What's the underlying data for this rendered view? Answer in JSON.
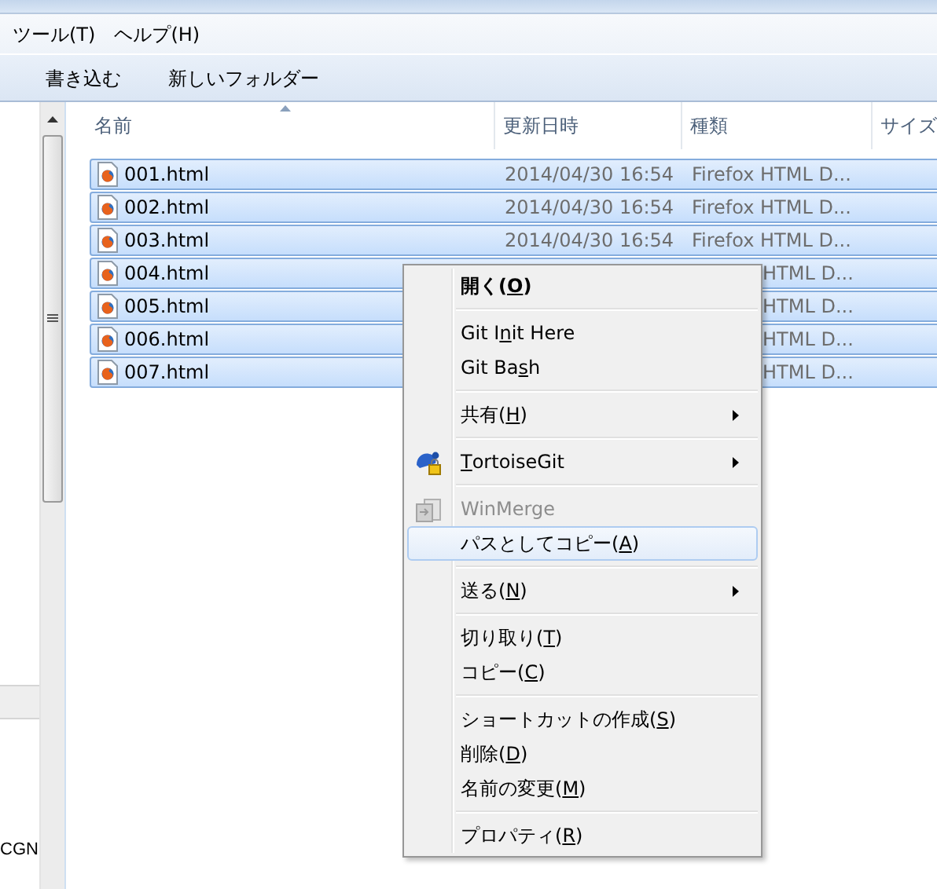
{
  "menu_bar": [
    "ツール(T)",
    "ヘルプ(H)"
  ],
  "toolbar": [
    "書き込む",
    "新しいフォルダー"
  ],
  "nav_pane": {
    "items": [
      "CGN"
    ]
  },
  "file_list": {
    "columns": [
      {
        "label": "名前",
        "sorted": true
      },
      {
        "label": "更新日時",
        "sorted": false
      },
      {
        "label": "種類",
        "sorted": false
      },
      {
        "label": "サイズ",
        "sorted": false
      }
    ],
    "rows": [
      {
        "name": "001.html",
        "date": "2014/04/30 16:54",
        "type": "Firefox HTML D...",
        "selected": true
      },
      {
        "name": "002.html",
        "date": "2014/04/30 16:54",
        "type": "Firefox HTML D...",
        "selected": true
      },
      {
        "name": "003.html",
        "date": "2014/04/30 16:54",
        "type": "Firefox HTML D...",
        "selected": true
      },
      {
        "name": "004.html",
        "type": "HTML D...",
        "selected": true
      },
      {
        "name": "005.html",
        "type": "HTML D...",
        "selected": true
      },
      {
        "name": "006.html",
        "type": "HTML D...",
        "selected": true
      },
      {
        "name": "007.html",
        "type": "HTML D...",
        "selected": true
      }
    ]
  },
  "context_menu": {
    "items": [
      {
        "kind": "item",
        "label": "開く(",
        "key": "O",
        "after": ")",
        "default": true,
        "disabled": false,
        "submenu": false,
        "highlighted": false
      },
      {
        "kind": "separator"
      },
      {
        "kind": "item",
        "label": "Git I",
        "key": "n",
        "after": "it Here",
        "default": false,
        "disabled": false,
        "submenu": false,
        "highlighted": false
      },
      {
        "kind": "item",
        "label": "Git Ba",
        "key": "s",
        "after": "h",
        "default": false,
        "disabled": false,
        "submenu": false,
        "highlighted": false
      },
      {
        "kind": "separator"
      },
      {
        "kind": "item",
        "label": "共有(",
        "key": "H",
        "after": ")",
        "default": false,
        "disabled": false,
        "submenu": true,
        "highlighted": false
      },
      {
        "kind": "separator"
      },
      {
        "kind": "tortoise",
        "key": "T",
        "after": "ortoiseGit",
        "default": false,
        "disabled": false,
        "submenu": true,
        "highlighted": false
      },
      {
        "kind": "separator"
      },
      {
        "kind": "merge",
        "label": "WinMerge",
        "default": false,
        "disabled": true,
        "submenu": false,
        "highlighted": false
      },
      {
        "kind": "item",
        "label": "パスとしてコピー(",
        "key": "A",
        "after": ")",
        "default": false,
        "disabled": false,
        "submenu": false,
        "highlighted": true
      },
      {
        "kind": "separator"
      },
      {
        "kind": "item",
        "label": "送る(",
        "key": "N",
        "after": ")",
        "default": false,
        "disabled": false,
        "submenu": true,
        "highlighted": false
      },
      {
        "kind": "separator"
      },
      {
        "kind": "item",
        "label": "切り取り(",
        "key": "T",
        "after": ")",
        "default": false,
        "disabled": false,
        "submenu": false,
        "highlighted": false
      },
      {
        "kind": "item",
        "label": "コピー(",
        "key": "C",
        "after": ")",
        "default": false,
        "disabled": false,
        "submenu": false,
        "highlighted": false
      },
      {
        "kind": "separator"
      },
      {
        "kind": "item",
        "label": "ショートカットの作成(",
        "key": "S",
        "after": ")",
        "default": false,
        "disabled": false,
        "submenu": false,
        "highlighted": false
      },
      {
        "kind": "item",
        "label": "削除(",
        "key": "D",
        "after": ")",
        "default": false,
        "disabled": false,
        "submenu": false,
        "highlighted": false
      },
      {
        "kind": "item",
        "label": "名前の変更(",
        "key": "M",
        "after": ")",
        "default": false,
        "disabled": false,
        "submenu": false,
        "highlighted": false
      },
      {
        "kind": "separator"
      },
      {
        "kind": "item",
        "label": "プロパティ(",
        "key": "R",
        "after": ")",
        "default": false,
        "disabled": false,
        "submenu": false,
        "highlighted": false
      }
    ]
  }
}
